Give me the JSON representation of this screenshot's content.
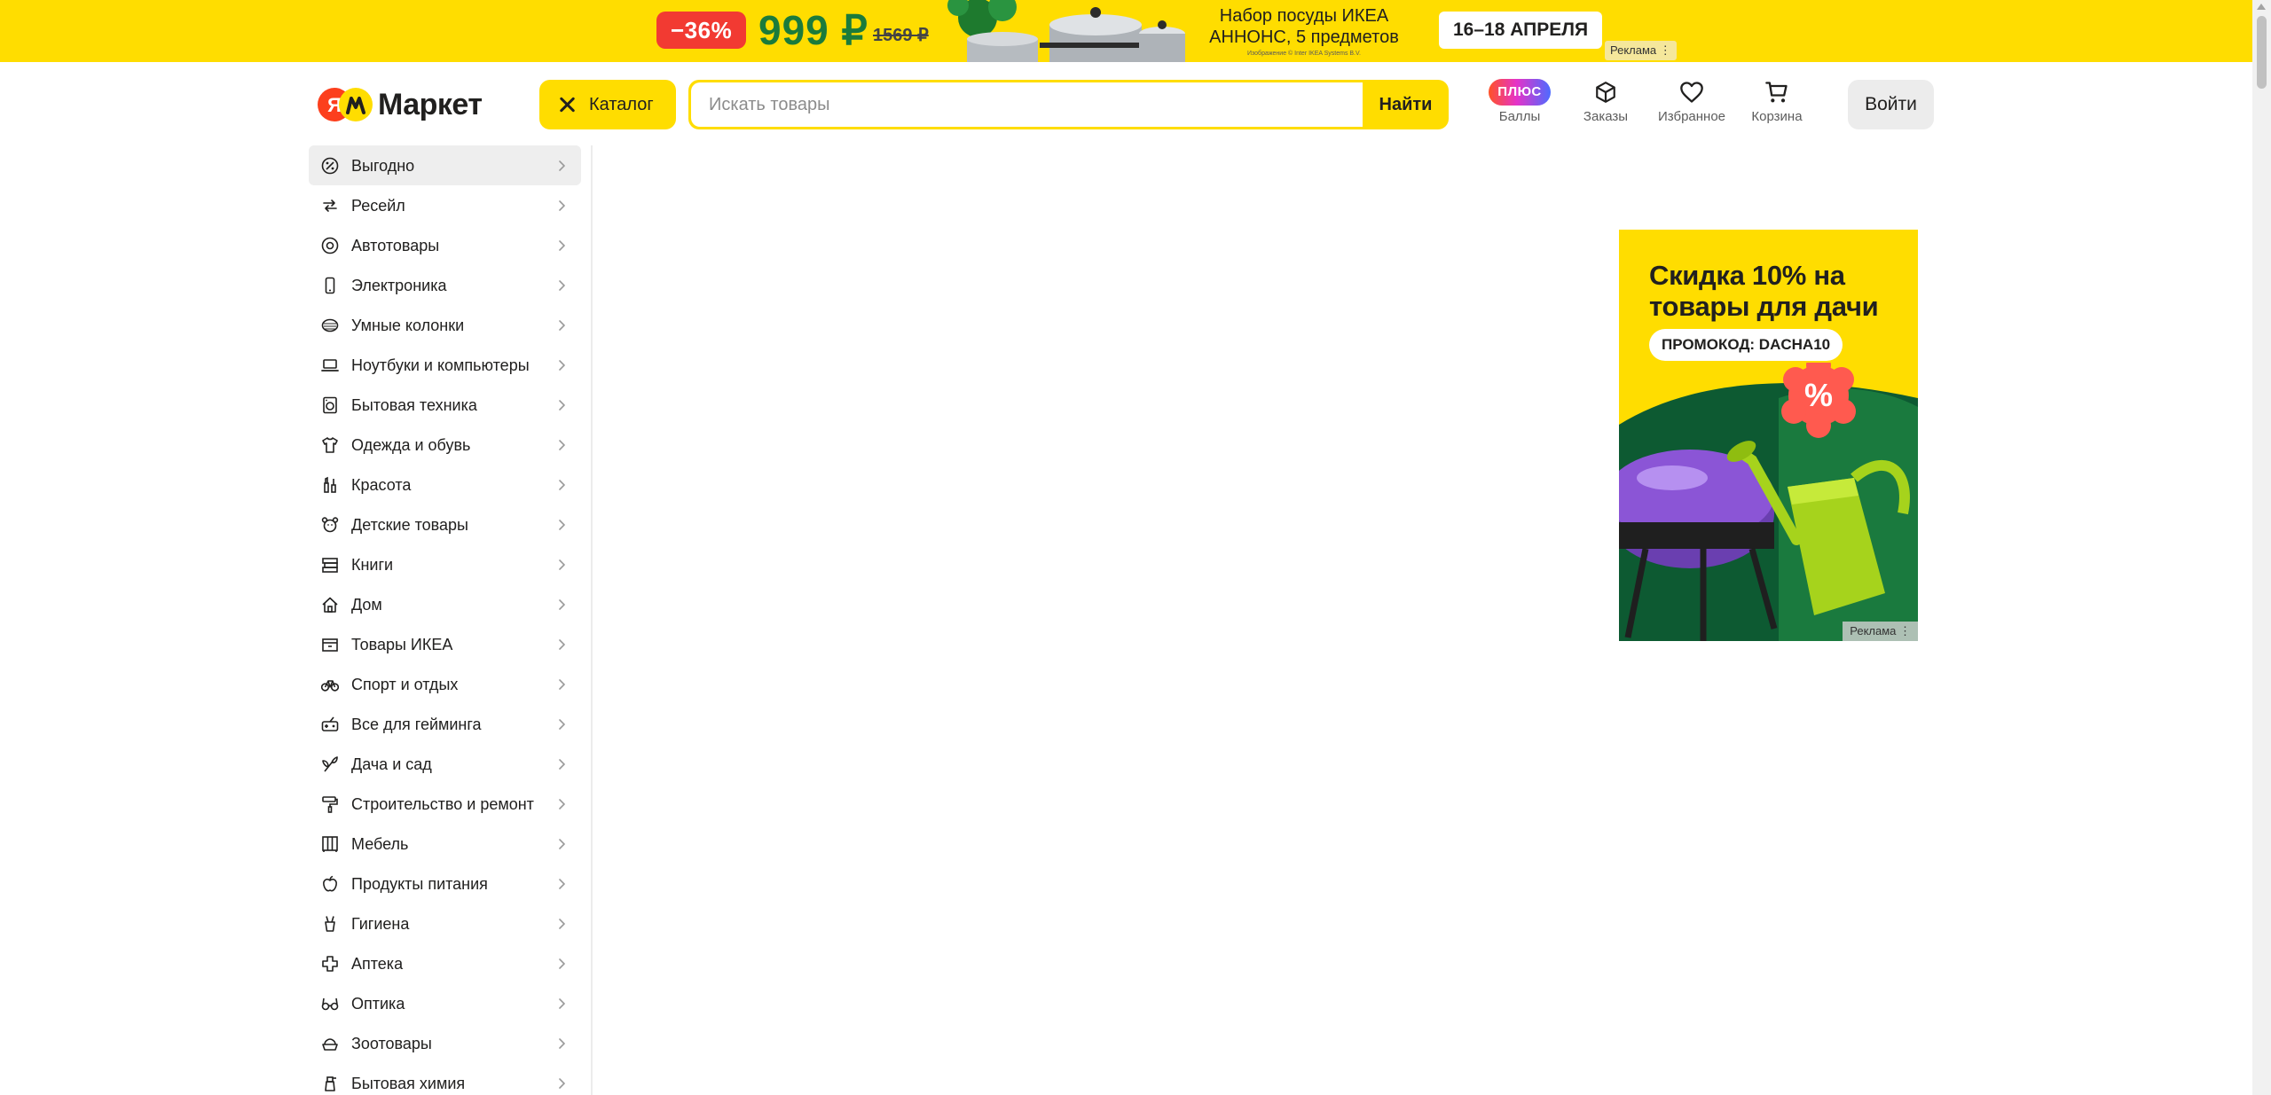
{
  "promo": {
    "discount": "−36%",
    "price": "999 ₽",
    "old_price": "1569 ₽",
    "title_line1": "Набор посуды ИКЕА",
    "title_line2": "АННОНС, 5 предметов",
    "fine_print": "Изображение © Inter IKEA Systems B.V.",
    "dates": "16–18 АПРЕЛЯ",
    "ad_label": "Реклама ⋮"
  },
  "header": {
    "logo_text": "Маркет",
    "catalog_label": "Каталог",
    "search_placeholder": "Искать товары",
    "search_button": "Найти",
    "plus_badge": "ПЛЮС",
    "points_label": "Баллы",
    "orders_label": "Заказы",
    "favorites_label": "Избранное",
    "cart_label": "Корзина",
    "login_label": "Войти"
  },
  "sidebar": {
    "items": [
      {
        "label": "Выгодно",
        "icon": "percent-icon"
      },
      {
        "label": "Ресейл",
        "icon": "resale-icon"
      },
      {
        "label": "Автотовары",
        "icon": "tire-icon"
      },
      {
        "label": "Электроника",
        "icon": "phone-icon"
      },
      {
        "label": "Умные колонки",
        "icon": "speaker-icon"
      },
      {
        "label": "Ноутбуки и компьютеры",
        "icon": "laptop-icon"
      },
      {
        "label": "Бытовая техника",
        "icon": "washing-machine-icon"
      },
      {
        "label": "Одежда и обувь",
        "icon": "tshirt-icon"
      },
      {
        "label": "Красота",
        "icon": "cosmetics-icon"
      },
      {
        "label": "Детские товары",
        "icon": "teddy-bear-icon"
      },
      {
        "label": "Книги",
        "icon": "books-icon"
      },
      {
        "label": "Дом",
        "icon": "house-icon"
      },
      {
        "label": "Товары ИКЕА",
        "icon": "ikea-box-icon"
      },
      {
        "label": "Спорт и отдых",
        "icon": "bicycle-icon"
      },
      {
        "label": "Все для гейминга",
        "icon": "gamepad-icon"
      },
      {
        "label": "Дача и сад",
        "icon": "plant-icon"
      },
      {
        "label": "Строительство и ремонт",
        "icon": "paint-roller-icon"
      },
      {
        "label": "Мебель",
        "icon": "wardrobe-icon"
      },
      {
        "label": "Продукты питания",
        "icon": "apple-icon"
      },
      {
        "label": "Гигиена",
        "icon": "toothbrush-cup-icon"
      },
      {
        "label": "Аптека",
        "icon": "medical-cross-icon"
      },
      {
        "label": "Оптика",
        "icon": "glasses-icon"
      },
      {
        "label": "Зоотовары",
        "icon": "pet-bowl-icon"
      },
      {
        "label": "Бытовая химия",
        "icon": "spray-bottle-icon"
      }
    ]
  },
  "side_ad": {
    "title": "Скидка 10% на товары для дачи",
    "promo_code": "ПРОМОКОД: DACHA10",
    "ad_label": "Реклама ⋮"
  },
  "colors": {
    "brand_yellow": "#ffdd00",
    "discount_red": "#f23a32",
    "price_green": "#1b7b3b",
    "active_item_bg": "#eeeeee"
  }
}
